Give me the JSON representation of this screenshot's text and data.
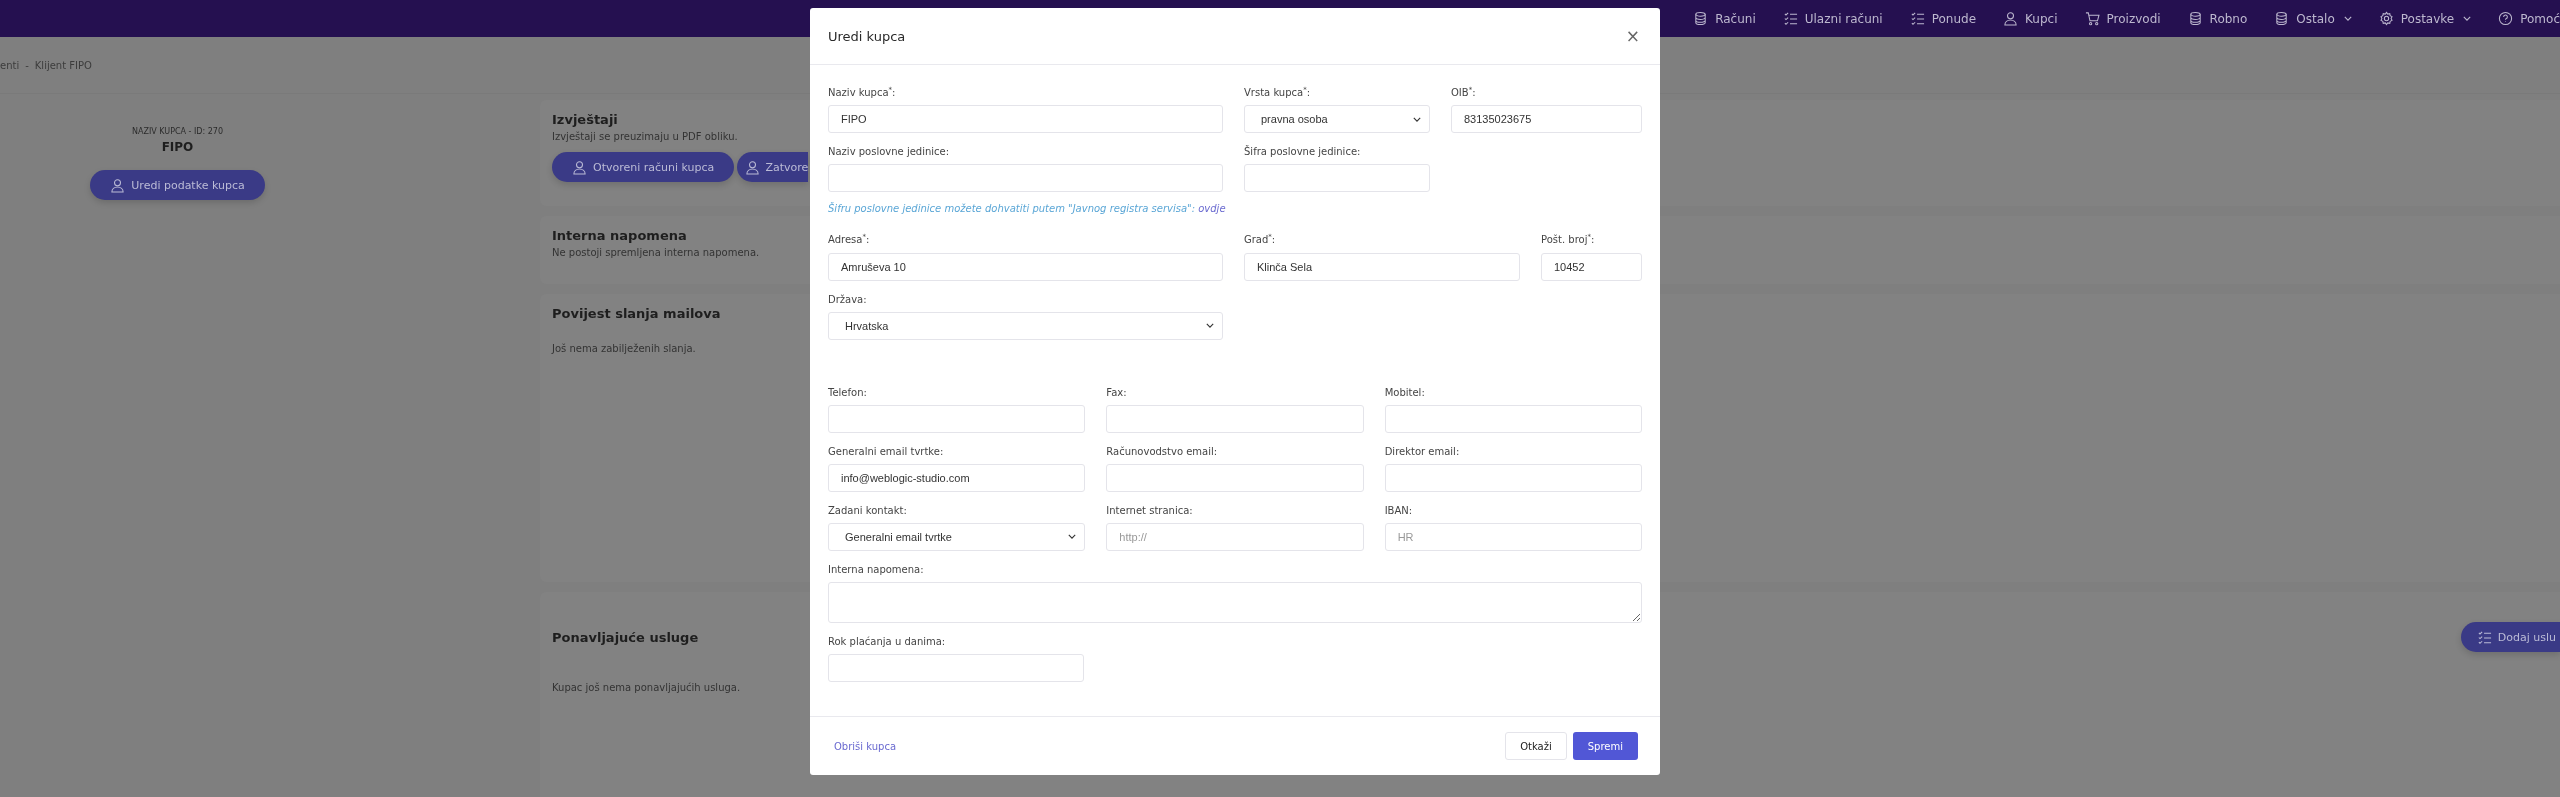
{
  "navbar": {
    "items": [
      {
        "label": "Računi",
        "dropdown": false
      },
      {
        "label": "Ulazni računi",
        "dropdown": false
      },
      {
        "label": "Ponude",
        "dropdown": false
      },
      {
        "label": "Kupci",
        "dropdown": false
      },
      {
        "label": "Proizvodi",
        "dropdown": false
      },
      {
        "label": "Robno",
        "dropdown": false
      },
      {
        "label": "Ostalo",
        "dropdown": true
      },
      {
        "label": "Postavke",
        "dropdown": true
      },
      {
        "label": "Pomoć",
        "dropdown": false
      }
    ]
  },
  "breadcrumb": {
    "items": [
      "enti",
      "Klijent FIPO"
    ],
    "separator": "-"
  },
  "customer_panel": {
    "caption": "NAZIV KUPCA - ID: 270",
    "name": "FIPO",
    "edit_button": "Uredi podatke kupca"
  },
  "cards": [
    {
      "title": "Izvještaji",
      "text": "Izvještaji se preuzimaju u PDF obliku.",
      "buttons": [
        "Otvoreni računi kupca",
        "Zatvore"
      ]
    },
    {
      "title": "Interna napomena",
      "text": "Ne postoji spremljena interna napomena."
    },
    {
      "title": "Povijest slanja mailova",
      "text": "Još nema zabilježenih slanja."
    },
    {
      "title": "Ponavljajuće usluge",
      "text": "Kupac još nema ponavljajućih usluga.",
      "action": "Dodaj uslu"
    }
  ],
  "modal": {
    "title": "Uredi kupca",
    "close": "×",
    "sections": [
      {
        "kind": "fields",
        "fields": [
          {
            "label": "Naziv kupca$^{*}$:",
            "kind": "text",
            "value": "FIPO"
          },
          {
            "label": "Vrsta kupca$^{*}$:",
            "kind": "select",
            "value": "pravna osoba"
          },
          {
            "label": "OIB$^{*}$:",
            "kind": "text",
            "value": "83135023675"
          }
        ]
      },
      {
        "kind": "fields",
        "fields": [
          {
            "label": "Naziv poslovne jedinice:",
            "kind": "text"
          },
          {
            "label": "Šifra poslovne jedinice:",
            "kind": "text"
          }
        ]
      },
      {
        "kind": "hint",
        "text": "Šifru poslovne jedinice možete dohvatiti putem \"Javnog registra servisa\":",
        "link": "ovdje"
      },
      {
        "kind": "fields",
        "fields": [
          {
            "label": "Adresa$^{*}$:",
            "kind": "text",
            "value": "Amruševa 10"
          },
          {
            "label": "Grad$^{*}$:",
            "kind": "text",
            "value": "Klinča Sela"
          },
          {
            "label": "Pošt. broj$^{*}$:",
            "kind": "text",
            "value": "10452"
          }
        ]
      },
      {
        "kind": "fields",
        "fields": [
          {
            "label": "Država:",
            "kind": "select",
            "value": "Hrvatska"
          }
        ]
      },
      {
        "kind": "fields",
        "fields": [
          {
            "label": "Telefon:",
            "kind": "text"
          },
          {
            "label": "Fax:",
            "kind": "text"
          },
          {
            "label": "Mobitel:",
            "kind": "text"
          }
        ]
      },
      {
        "kind": "fields",
        "fields": [
          {
            "label": "Generalni email tvrtke:",
            "kind": "text",
            "value": "info@weblogic-studio.com"
          },
          {
            "label": "Računovodstvo email:",
            "kind": "text"
          },
          {
            "label": "Direktor email:",
            "kind": "text"
          }
        ]
      },
      {
        "kind": "fields",
        "fields": [
          {
            "label": "Zadani kontakt:",
            "kind": "select",
            "value": "Generalni email tvrtke"
          },
          {
            "label": "Internet stranica:",
            "kind": "text",
            "placeholder": "http://"
          },
          {
            "label": "IBAN:",
            "kind": "text",
            "placeholder": "HR"
          }
        ]
      },
      {
        "kind": "fields",
        "fields": [
          {
            "label": "Interna napomena:",
            "kind": "textarea"
          }
        ]
      },
      {
        "kind": "fields",
        "fields": [
          {
            "label": "Rok plaćanja u danima:",
            "kind": "text"
          }
        ]
      }
    ],
    "footer": {
      "delete": "Obriši kupca",
      "cancel": "Otkaži",
      "save": "Spremi"
    }
  }
}
